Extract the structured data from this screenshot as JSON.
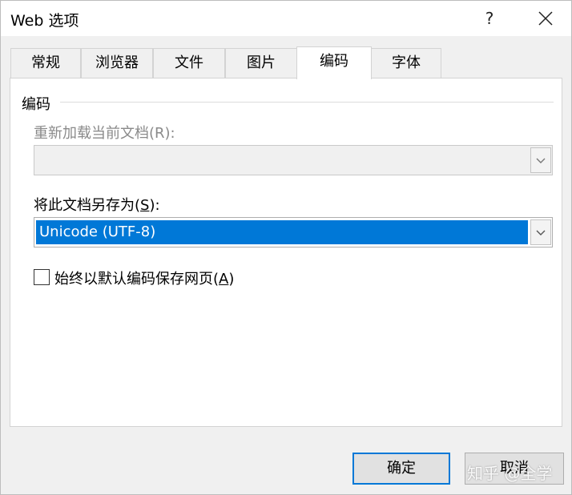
{
  "window": {
    "title": "Web 选项",
    "help_label": "?"
  },
  "tabs": [
    {
      "label": "常规",
      "active": false
    },
    {
      "label": "浏览器",
      "active": false
    },
    {
      "label": "文件",
      "active": false
    },
    {
      "label": "图片",
      "active": false
    },
    {
      "label": "编码",
      "active": true
    },
    {
      "label": "字体",
      "active": false
    }
  ],
  "encoding": {
    "group_title": "编码",
    "reload_label": "重新加载当前文档(R):",
    "reload_value": "",
    "reload_enabled": false,
    "save_as_label_prefix": "将此文档另存为(",
    "save_as_accesskey": "S",
    "save_as_label_suffix": "):",
    "save_as_value": "Unicode (UTF-8)",
    "always_default_prefix": "始终以默认编码保存网页(",
    "always_default_accesskey": "A",
    "always_default_suffix": ")",
    "always_default_checked": false
  },
  "buttons": {
    "ok_label": "确定",
    "cancel_label": "取消"
  },
  "watermark": "知乎 @全学",
  "colors": {
    "selection": "#0078d7",
    "default_button_border": "#0078d7",
    "disabled_text": "#8a8a8a"
  }
}
